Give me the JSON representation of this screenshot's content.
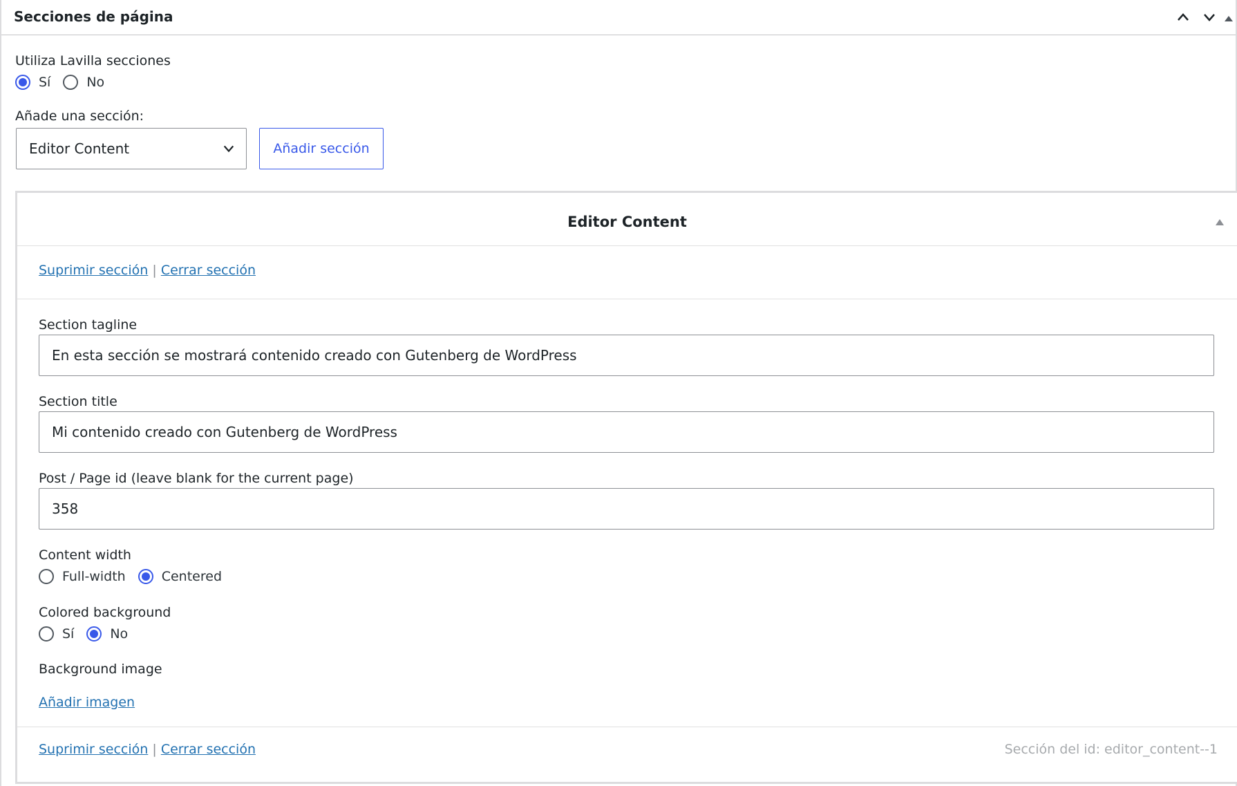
{
  "metabox": {
    "title": "Secciones de página"
  },
  "use_sections": {
    "label": "Utiliza Lavilla secciones",
    "options": [
      "Sí",
      "No"
    ],
    "selected": "Sí"
  },
  "add_section": {
    "label": "Añade una sección:",
    "select_value": "Editor Content",
    "button_label": "Añadir sección"
  },
  "section": {
    "header_title": "Editor Content",
    "delete_link": "Suprimir sección",
    "separator": "|",
    "close_link": "Cerrar sección",
    "tagline_label": "Section tagline",
    "tagline_value": "En esta sección se mostrará contenido creado con Gutenberg de WordPress",
    "title_label": "Section title",
    "title_value": "Mi contenido creado con Gutenberg de WordPress",
    "post_id_label": "Post / Page id (leave blank for the current page)",
    "post_id_value": "358",
    "content_width": {
      "label": "Content width",
      "options": [
        "Full-width",
        "Centered"
      ],
      "selected": "Centered"
    },
    "colored_background": {
      "label": "Colored background",
      "options": [
        "Sí",
        "No"
      ],
      "selected": "No"
    },
    "background_image_label": "Background image",
    "add_image_link": "Añadir imagen",
    "section_id_text": "Sección del id: editor_content--1"
  },
  "colors": {
    "accent": "#3858e9",
    "link": "#2271b1",
    "border": "#8c8f94"
  }
}
